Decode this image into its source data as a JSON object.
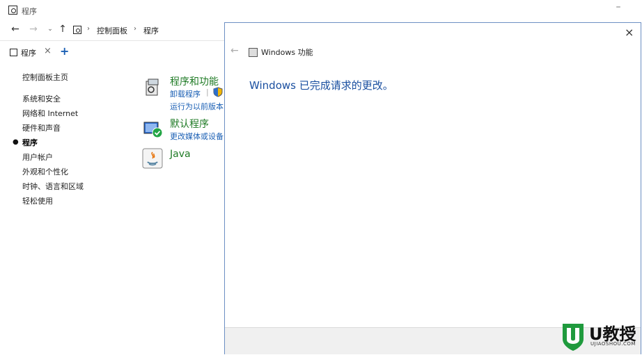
{
  "window": {
    "title": "程序"
  },
  "address_bar": {
    "breadcrumbs": [
      "控制面板",
      "程序"
    ]
  },
  "tab": {
    "label": "程序",
    "close": "×",
    "add": "+"
  },
  "sidebar": {
    "home": "控制面板主页",
    "items": [
      {
        "label": "系统和安全"
      },
      {
        "label": "网络和 Internet"
      },
      {
        "label": "硬件和声音"
      },
      {
        "label": "程序",
        "active": true
      },
      {
        "label": "用户帐户"
      },
      {
        "label": "外观和个性化"
      },
      {
        "label": "时钟、语言和区域"
      },
      {
        "label": "轻松使用"
      }
    ]
  },
  "categories": [
    {
      "title": "程序和功能",
      "links": [
        "卸载程序",
        "运行为以前版本",
        "|"
      ],
      "icon": "programs-features-icon"
    },
    {
      "title": "默认程序",
      "links": [
        "更改媒体或设备"
      ],
      "icon": "default-programs-icon"
    },
    {
      "title": "Java",
      "links": [],
      "icon": "java-icon"
    }
  ],
  "dialog": {
    "title": "Windows 功能",
    "message": "Windows 已完成请求的更改。",
    "close": "×"
  },
  "watermark": {
    "brand": "U教授",
    "domain": "UJIAOSHOU.COM"
  },
  "colors": {
    "link": "#1a5fb4",
    "category_title": "#1e7a24",
    "dialog_border": "#6c8fc3",
    "dialog_message": "#1a4fa0"
  }
}
